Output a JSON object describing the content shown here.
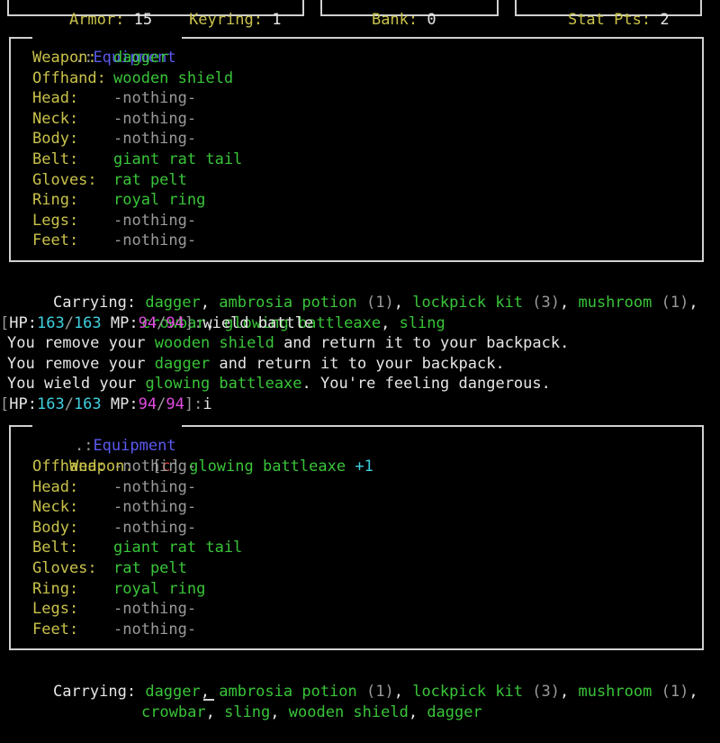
{
  "top_fragments": {
    "armor_label": "Armor:",
    "armor_value": "15",
    "keyring_label": "Keyring:",
    "keyring_value": "1",
    "bank_label": "Bank:",
    "bank_value": "0",
    "stat_pts_label": "Stat Pts:",
    "stat_pts_value": "2"
  },
  "equipment_block_1": {
    "title_prefix": ".:",
    "title": "Equipment",
    "rows": [
      {
        "slot": "Weapon:",
        "item": "dagger",
        "empty": false
      },
      {
        "slot": "Offhand:",
        "item": "wooden shield",
        "empty": false
      },
      {
        "slot": "Head:",
        "item": "-nothing-",
        "empty": true
      },
      {
        "slot": "Neck:",
        "item": "-nothing-",
        "empty": true
      },
      {
        "slot": "Body:",
        "item": "-nothing-",
        "empty": true
      },
      {
        "slot": "Belt:",
        "item": "giant rat tail",
        "empty": false
      },
      {
        "slot": "Gloves:",
        "item": "rat pelt",
        "empty": false
      },
      {
        "slot": "Ring:",
        "item": "royal ring",
        "empty": false
      },
      {
        "slot": "Legs:",
        "item": "-nothing-",
        "empty": true
      },
      {
        "slot": "Feet:",
        "item": "-nothing-",
        "empty": true
      }
    ]
  },
  "carrying_1": {
    "label": "Carrying:",
    "line1": [
      {
        "t": "dagger",
        "cls": "g"
      },
      {
        "t": ", ",
        "cls": "w"
      },
      {
        "t": "ambrosia potion",
        "cls": "g"
      },
      {
        "t": " (1)",
        "cls": "d"
      },
      {
        "t": ", ",
        "cls": "w"
      },
      {
        "t": "lockpick kit",
        "cls": "g"
      },
      {
        "t": " (3)",
        "cls": "d"
      },
      {
        "t": ", ",
        "cls": "w"
      },
      {
        "t": "mushroom",
        "cls": "g"
      },
      {
        "t": " (1)",
        "cls": "d"
      },
      {
        "t": ",",
        "cls": "w"
      }
    ],
    "line2": [
      {
        "t": "crowbar",
        "cls": "g"
      },
      {
        "t": ", ",
        "cls": "w"
      },
      {
        "t": "glowing battleaxe",
        "cls": "g"
      },
      {
        "t": ", ",
        "cls": "w"
      },
      {
        "t": "sling",
        "cls": "g"
      }
    ]
  },
  "prompt_1": {
    "hp_label": "HP:",
    "hp_cur": "163",
    "hp_max": "163",
    "mp_label": "MP:",
    "mp_cur": "94",
    "mp_max": "94",
    "command": "wield battle"
  },
  "messages": [
    [
      {
        "t": "You remove your ",
        "cls": "w"
      },
      {
        "t": "wooden shield",
        "cls": "g"
      },
      {
        "t": " and return it to your backpack.",
        "cls": "w"
      }
    ],
    [
      {
        "t": "You remove your ",
        "cls": "w"
      },
      {
        "t": "dagger",
        "cls": "g"
      },
      {
        "t": " and return it to your backpack.",
        "cls": "w"
      }
    ],
    [
      {
        "t": "You wield your ",
        "cls": "w"
      },
      {
        "t": "glowing battleaxe",
        "cls": "g"
      },
      {
        "t": ". You're feeling dangerous.",
        "cls": "w"
      }
    ]
  ],
  "prompt_2": {
    "hp_label": "HP:",
    "hp_cur": "163",
    "hp_max": "163",
    "mp_label": "MP:",
    "mp_cur": "94",
    "mp_max": "94",
    "command": "i"
  },
  "equipment_block_2": {
    "title_prefix": ".:",
    "title": "Equipment",
    "weapon_slot": "Weapon:",
    "weapon_tag": "c",
    "weapon_item": "glowing battleaxe",
    "weapon_bonus": "+1",
    "rows": [
      {
        "slot": "Offhand:",
        "item": "-nothing-",
        "empty": true
      },
      {
        "slot": "Head:",
        "item": "-nothing-",
        "empty": true
      },
      {
        "slot": "Neck:",
        "item": "-nothing-",
        "empty": true
      },
      {
        "slot": "Body:",
        "item": "-nothing-",
        "empty": true
      },
      {
        "slot": "Belt:",
        "item": "giant rat tail",
        "empty": false
      },
      {
        "slot": "Gloves:",
        "item": "rat pelt",
        "empty": false
      },
      {
        "slot": "Ring:",
        "item": "royal ring",
        "empty": false
      },
      {
        "slot": "Legs:",
        "item": "-nothing-",
        "empty": true
      },
      {
        "slot": "Feet:",
        "item": "-nothing-",
        "empty": true
      }
    ]
  },
  "carrying_2": {
    "label": "Carrying:",
    "line1": [
      {
        "t": "dagger",
        "cls": "g"
      },
      {
        "t": ", ",
        "cls": "w"
      },
      {
        "t": "ambrosia potion",
        "cls": "g"
      },
      {
        "t": " (1)",
        "cls": "d"
      },
      {
        "t": ", ",
        "cls": "w"
      },
      {
        "t": "lockpick kit",
        "cls": "g"
      },
      {
        "t": " (3)",
        "cls": "d"
      },
      {
        "t": ", ",
        "cls": "w"
      },
      {
        "t": "mushroom",
        "cls": "g"
      },
      {
        "t": " (1)",
        "cls": "d"
      },
      {
        "t": ",",
        "cls": "w"
      }
    ],
    "line2": [
      {
        "t": "crowbar",
        "cls": "g"
      },
      {
        "t": ", ",
        "cls": "w"
      },
      {
        "t": "sling",
        "cls": "g"
      },
      {
        "t": ", ",
        "cls": "w"
      },
      {
        "t": "wooden shield",
        "cls": "g"
      },
      {
        "t": ", ",
        "cls": "w"
      },
      {
        "t": "dagger",
        "cls": "g"
      }
    ]
  },
  "colors": {
    "background": "#000000",
    "label_yellow": "#c9c24a",
    "item_green": "#39c539",
    "dim_gray": "#9a9a9a",
    "hp_cyan": "#3fd0e0",
    "mp_magenta": "#e24ae2",
    "title_blue": "#5a5af0",
    "tag_red": "#e04040"
  }
}
